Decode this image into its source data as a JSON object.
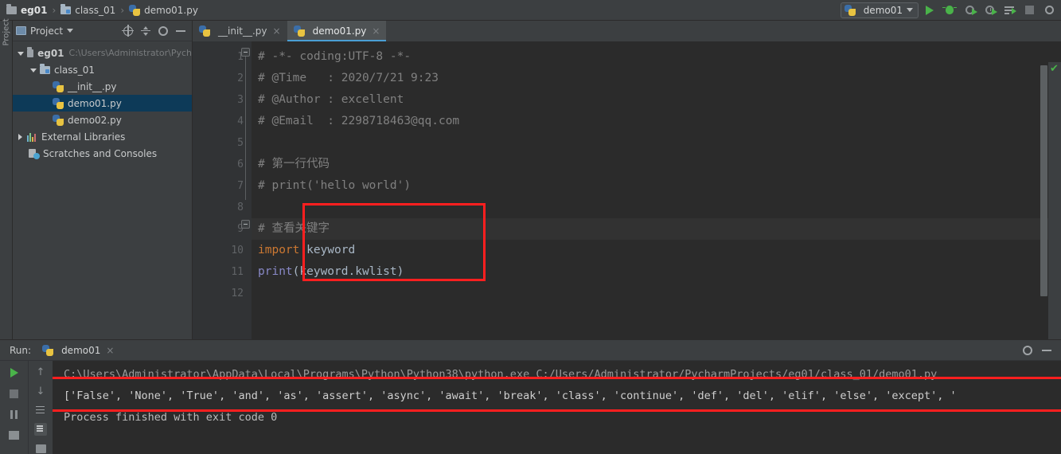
{
  "breadcrumb": {
    "items": [
      {
        "label": "eg01",
        "icon": "folder-icon"
      },
      {
        "label": "class_01",
        "icon": "source-folder-icon"
      },
      {
        "label": "demo01.py",
        "icon": "python-file-icon"
      }
    ],
    "separator": "›"
  },
  "toolbar": {
    "run_config_name": "demo01",
    "buttons": [
      {
        "name": "run-button",
        "icon": "play-icon"
      },
      {
        "name": "debug-button",
        "icon": "bug-icon"
      },
      {
        "name": "run-with-coverage-button",
        "icon": "coverage-icon"
      },
      {
        "name": "profile-button",
        "icon": "profiler-icon"
      },
      {
        "name": "run-with-console-button",
        "icon": "lines-play-icon"
      },
      {
        "name": "stop-button",
        "icon": "stop-icon"
      },
      {
        "name": "search-everywhere-button",
        "icon": "search-icon"
      }
    ]
  },
  "project_panel": {
    "title": "Project",
    "actions": [
      {
        "name": "select-opened-file-button",
        "icon": "target-icon"
      },
      {
        "name": "collapse-all-button",
        "icon": "collapse-icon"
      },
      {
        "name": "settings-button",
        "icon": "gear-icon"
      },
      {
        "name": "hide-button",
        "icon": "minimize-icon"
      }
    ],
    "tree": [
      {
        "label": "eg01",
        "path": "C:\\Users\\Administrator\\Pych",
        "icon": "folder-icon",
        "arrow": "down",
        "indent": 0,
        "bold": true,
        "selected": false
      },
      {
        "label": "class_01",
        "path": "",
        "icon": "source-folder-icon",
        "arrow": "down",
        "indent": 1,
        "bold": false,
        "selected": false
      },
      {
        "label": "__init__.py",
        "path": "",
        "icon": "python-file-icon",
        "arrow": "none",
        "indent": 2,
        "bold": false,
        "selected": false
      },
      {
        "label": "demo01.py",
        "path": "",
        "icon": "python-file-icon",
        "arrow": "none",
        "indent": 2,
        "bold": false,
        "selected": true
      },
      {
        "label": "demo02.py",
        "path": "",
        "icon": "python-file-icon",
        "arrow": "none",
        "indent": 2,
        "bold": false,
        "selected": false
      },
      {
        "label": "External Libraries",
        "path": "",
        "icon": "libraries-icon",
        "arrow": "right",
        "indent": 0,
        "bold": false,
        "selected": false
      },
      {
        "label": "Scratches and Consoles",
        "path": "",
        "icon": "scratches-icon",
        "arrow": "none",
        "indent": 0,
        "bold": false,
        "selected": false
      }
    ]
  },
  "editor": {
    "tabs": [
      {
        "label": "__init__.py",
        "active": false,
        "close": "×"
      },
      {
        "label": "demo01.py",
        "active": true,
        "close": "×"
      }
    ],
    "line_numbers": [
      "1",
      "2",
      "3",
      "4",
      "5",
      "6",
      "7",
      "8",
      "9",
      "10",
      "11",
      "12"
    ],
    "lines": [
      {
        "n": 1,
        "segments": [
          {
            "text": "# -*- coding:UTF-8 -*-",
            "cls": "cm"
          }
        ],
        "caret": false
      },
      {
        "n": 2,
        "segments": [
          {
            "text": "# @Time   : 2020/7/21 9:23",
            "cls": "cm"
          }
        ],
        "caret": false
      },
      {
        "n": 3,
        "segments": [
          {
            "text": "# @Author : excellent",
            "cls": "cm"
          }
        ],
        "caret": false
      },
      {
        "n": 4,
        "segments": [
          {
            "text": "# @Email  : 2298718463@qq.com",
            "cls": "cm"
          }
        ],
        "caret": false
      },
      {
        "n": 5,
        "segments": [
          {
            "text": "",
            "cls": "cm"
          }
        ],
        "caret": false
      },
      {
        "n": 6,
        "segments": [
          {
            "text": "# 第一行代码",
            "cls": "cm"
          }
        ],
        "caret": false
      },
      {
        "n": 7,
        "segments": [
          {
            "text": "# print('hello world')",
            "cls": "cm"
          }
        ],
        "caret": false
      },
      {
        "n": 8,
        "segments": [
          {
            "text": "",
            "cls": "cm"
          }
        ],
        "caret": false
      },
      {
        "n": 9,
        "segments": [
          {
            "text": "# 查看关键字",
            "cls": "cm"
          }
        ],
        "caret": true
      },
      {
        "n": 10,
        "segments": [
          {
            "text": "import",
            "cls": "kw"
          },
          {
            "text": " keyword",
            "cls": "tx"
          }
        ],
        "caret": false
      },
      {
        "n": 11,
        "segments": [
          {
            "text": "print",
            "cls": "fn"
          },
          {
            "text": "(keyword.kwlist)",
            "cls": "tx"
          }
        ],
        "caret": false
      },
      {
        "n": 12,
        "segments": [
          {
            "text": "",
            "cls": "tx"
          }
        ],
        "caret": false
      }
    ],
    "inspection_status": "✔",
    "annotation_box_color": "#ff1f1f"
  },
  "run_panel": {
    "label": "Run:",
    "tab_name": "demo01",
    "tab_close": "×",
    "header_actions": [
      {
        "name": "settings-button",
        "icon": "gear-icon"
      },
      {
        "name": "hide-button",
        "icon": "minimize-icon"
      }
    ],
    "side_actions": [
      {
        "name": "rerun-button",
        "icon": "play-icon"
      },
      {
        "name": "stop-button",
        "icon": "stop-icon"
      },
      {
        "name": "pause-button",
        "icon": "pause-icon"
      },
      {
        "name": "show-in-grid-button",
        "icon": "grid-icon"
      }
    ],
    "side_actions2": [
      {
        "name": "up-the-stack-button",
        "icon": "arrow-up-icon"
      },
      {
        "name": "down-the-stack-button",
        "icon": "arrow-down-icon"
      },
      {
        "name": "soft-wrap-button",
        "icon": "wrap-icon"
      },
      {
        "name": "scroll-to-end-button",
        "icon": "scroll-end-icon"
      },
      {
        "name": "print-button",
        "icon": "print-icon"
      }
    ],
    "console": {
      "command": "C:\\Users\\Administrator\\AppData\\Local\\Programs\\Python\\Python38\\python.exe C:/Users/Administrator/PycharmProjects/eg01/class_01/demo01.py",
      "output": "['False', 'None', 'True', 'and', 'as', 'assert', 'async', 'await', 'break', 'class', 'continue', 'def', 'del', 'elif', 'else', 'except', '",
      "finished": "Process finished with exit code 0"
    }
  }
}
